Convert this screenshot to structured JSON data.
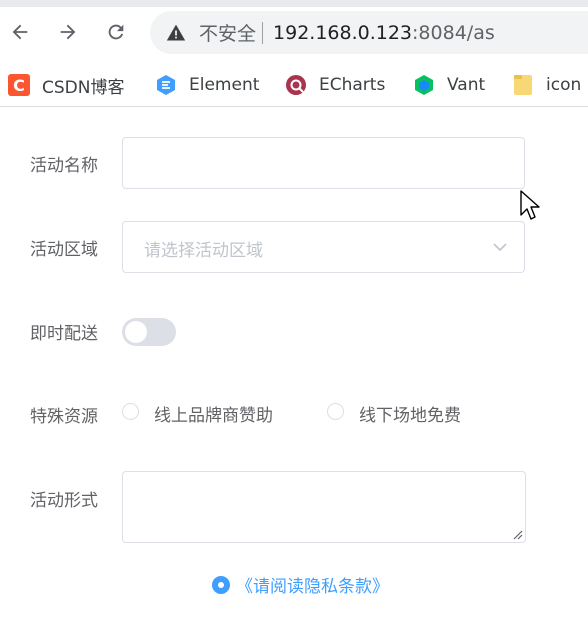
{
  "browser": {
    "security_label": "不安全",
    "url_host": "192.168.0.123",
    "url_rest": ":8084/as"
  },
  "bookmarks": [
    {
      "label": "CSDN博客",
      "icon": "csdn-icon",
      "color": "#fc5531"
    },
    {
      "label": "Element",
      "icon": "element-icon",
      "color": "#409eff"
    },
    {
      "label": "ECharts",
      "icon": "echarts-icon",
      "color": "#aa344d"
    },
    {
      "label": "Vant",
      "icon": "vant-icon",
      "color": "#07c160"
    },
    {
      "label": "icon",
      "icon": "folder-icon",
      "color": "#f8d775"
    }
  ],
  "form": {
    "name_label": "活动名称",
    "name_value": "",
    "region_label": "活动区域",
    "region_placeholder": "请选择活动区域",
    "delivery_label": "即时配送",
    "delivery_on": false,
    "resource_label": "特殊资源",
    "resource_options": [
      "线上品牌商赞助",
      "线下场地免费"
    ],
    "form_label": "活动形式",
    "form_value": "",
    "privacy_text": "《请阅读隐私条款》"
  },
  "colors": {
    "accent": "#409eff",
    "border": "#dcdfe6",
    "label": "#606266",
    "placeholder": "#c0c4cc"
  }
}
